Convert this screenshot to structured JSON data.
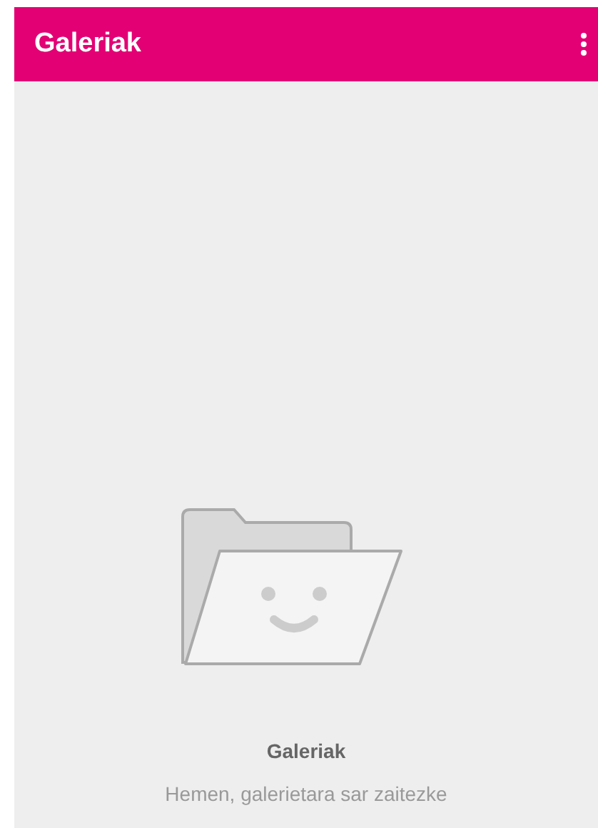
{
  "app_bar": {
    "title": "Galeriak"
  },
  "empty_state": {
    "title": "Galeriak",
    "message": "Hemen, galerietara sar zaitezke"
  }
}
